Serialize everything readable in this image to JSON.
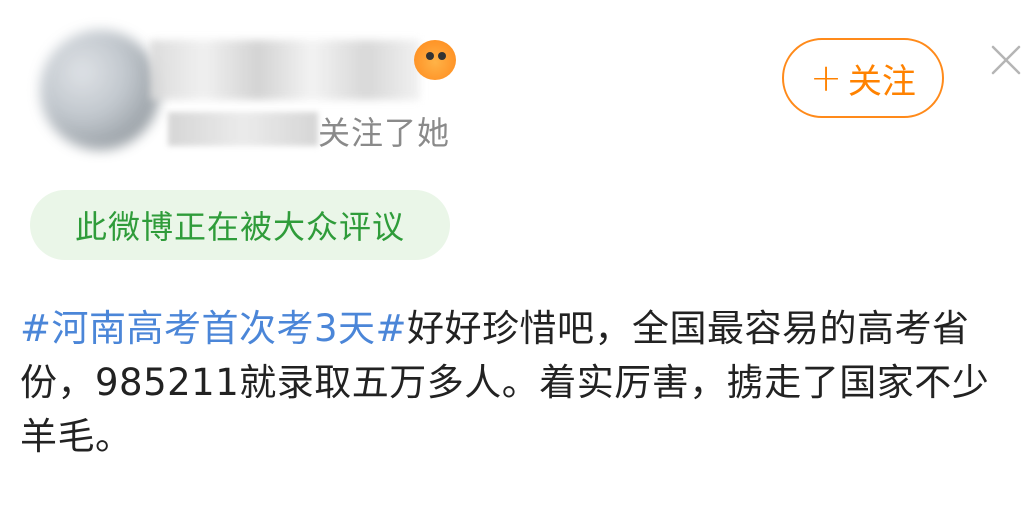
{
  "header": {
    "followers_text": "关注了她",
    "follow_button": {
      "plus": "+",
      "label": "关注"
    }
  },
  "hot_tag": {
    "label": "此微博正在被大众评议"
  },
  "post": {
    "topic": "#河南高考首次考3天#",
    "body": "好好珍惜吧，全国最容易的高考省份，985211就录取五万多人。着实厉害，掳走了国家不少羊毛。"
  },
  "colors": {
    "accent": "#ff8200",
    "topic_link": "#4b86d8",
    "hot_tag_text": "#2f9c3a",
    "hot_tag_bg": "#eaf6e8"
  },
  "icons": [
    "avatar",
    "user-badge-icon",
    "plus-icon",
    "close-icon"
  ]
}
